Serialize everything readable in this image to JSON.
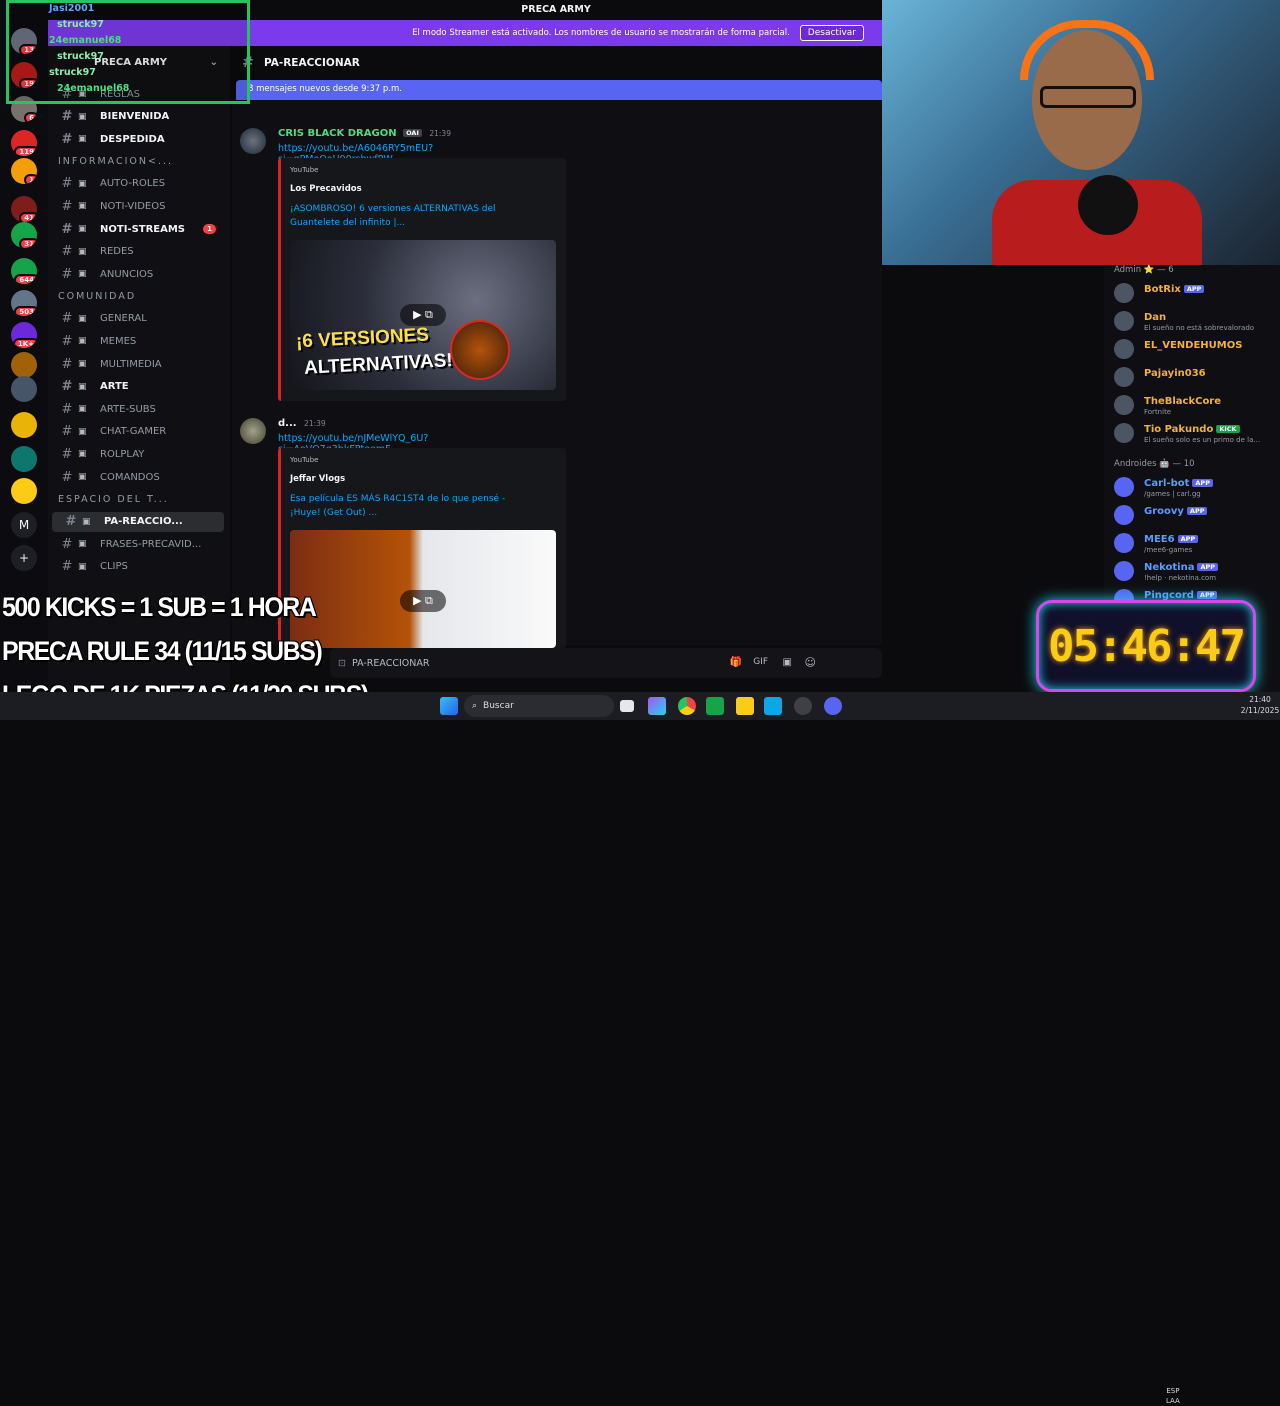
{
  "window": {
    "server_title": "PRECA ARMY"
  },
  "streamer_banner": {
    "text": "El modo Streamer está activado. Los nombres de usuario se mostrarán de forma parcial.",
    "button": "Desactivar"
  },
  "sidebar": {
    "server_name": "PRECA ARMY",
    "items": [
      {
        "type": "channel",
        "name": "REGLAS",
        "bold": false
      },
      {
        "type": "channel",
        "name": "BIENVENIDA",
        "bold": true
      },
      {
        "type": "channel",
        "name": "DESPEDIDA",
        "bold": true
      },
      {
        "type": "category",
        "name": "INFORMACION<..."
      },
      {
        "type": "channel",
        "name": "AUTO-ROLES",
        "bold": false
      },
      {
        "type": "channel",
        "name": "NOTI-VIDEOS",
        "bold": false
      },
      {
        "type": "channel",
        "name": "NOTI-STREAMS",
        "bold": true,
        "badge": "1"
      },
      {
        "type": "channel",
        "name": "REDES",
        "bold": false
      },
      {
        "type": "channel",
        "name": "ANUNCIOS",
        "bold": false
      },
      {
        "type": "category",
        "name": "COMUNIDAD"
      },
      {
        "type": "channel",
        "name": "GENERAL",
        "bold": false
      },
      {
        "type": "channel",
        "name": "MEMES",
        "bold": false
      },
      {
        "type": "channel",
        "name": "MULTIMEDIA",
        "bold": false
      },
      {
        "type": "channel",
        "name": "ARTE",
        "bold": true
      },
      {
        "type": "channel",
        "name": "ARTE-SUBS",
        "bold": false
      },
      {
        "type": "channel",
        "name": "CHAT-GAMER",
        "bold": false
      },
      {
        "type": "channel",
        "name": "ROLPLAY",
        "bold": false
      },
      {
        "type": "channel",
        "name": "COMANDOS",
        "bold": false
      },
      {
        "type": "category",
        "name": "ESPACIO DEL T..."
      },
      {
        "type": "channel",
        "name": "PA-REACCIO...",
        "bold": true,
        "selected": true
      },
      {
        "type": "channel",
        "name": "FRASES-PRECAVID...",
        "bold": false
      },
      {
        "type": "channel",
        "name": "CLIPS",
        "bold": false
      }
    ]
  },
  "rail_badges": [
    "13",
    "19",
    "6",
    "119",
    "1",
    "41",
    "31",
    "644",
    "503",
    "1K+"
  ],
  "channel_header": {
    "name": "PA-REACCIONAR"
  },
  "new_messages_bar": "8 mensajes nuevos desde 9:37 p.m.",
  "messages": [
    {
      "author": "CRIS BLACK DRAGON",
      "author_tag": "OAI",
      "time": "21:39",
      "link": "https://youtu.be/A6046RY5mEU?si=qPMoQoU00rsbwfPW",
      "embed": {
        "provider": "YouTube",
        "channel": "Los Precavidos",
        "title": "¡ASOMBROSO! 6 versiones ALTERNATIVAS del Guantelete del infinito |...",
        "thumb_text": [
          "¡6 VERSIONES",
          "ALTERNATIVAS!"
        ]
      }
    },
    {
      "author": "d...",
      "time": "21:39",
      "link": "https://youtu.be/nJMeWlYQ_6U?si=AoVQ7q3bkFPtoemF",
      "embed": {
        "provider": "YouTube",
        "channel": "Jeffar Vlogs",
        "title": "Esa película ES MÁS R4C1ST4 de lo que pensé - ¡Huye! (Get Out) ..."
      }
    }
  ],
  "input_placeholder": "PA-REACCIONAR",
  "members": {
    "groups": [
      {
        "header": "Admin ⭐ — 6",
        "items": [
          {
            "name": "BotRix",
            "tag": "APP",
            "sub": "",
            "color": "#f0b232"
          },
          {
            "name": "Dan",
            "tag": "",
            "sub": "El sueño no está sobrevalorado",
            "color": "#f0b232"
          },
          {
            "name": "EL_VENDEHUMOS",
            "tag": "",
            "sub": "",
            "color": "#f0b232"
          },
          {
            "name": "Pajayin036",
            "tag": "",
            "sub": "",
            "color": "#f0b232"
          },
          {
            "name": "TheBlackCore",
            "tag": "",
            "sub": "Fortnite",
            "color": "#f0b232"
          },
          {
            "name": "Tio Pakundo",
            "tag": "KICK",
            "sub": "El sueño solo es un primo de la...",
            "color": "#f0b232"
          }
        ]
      },
      {
        "header": "Androides 🤖 — 10",
        "items": [
          {
            "name": "Carl-bot",
            "tag": "APP",
            "sub": "/games | carl.gg",
            "color": "#5b9bff"
          },
          {
            "name": "Groovy",
            "tag": "APP",
            "sub": "",
            "color": "#5b9bff"
          },
          {
            "name": "MEE6",
            "tag": "APP",
            "sub": "/mee6-games",
            "color": "#5b9bff"
          },
          {
            "name": "Nekotina",
            "tag": "APP",
            "sub": "!help · nekotina.com",
            "color": "#5b9bff"
          },
          {
            "name": "Pingcord",
            "tag": "APP",
            "sub": "pingcord.xyz | pingcord | v2",
            "color": "#5b9bff"
          }
        ]
      }
    ]
  },
  "timer": "05:46:47",
  "stream_goals": [
    "500 KICKS = 1 SUB = 1 HORA",
    "PRECA RULE 34 (11/15 SUBS)",
    "LEGO DE 1K PIEZAS (11/20 SUBS)"
  ],
  "stream_chat": [
    {
      "user": "Jasi2001",
      "color": "#60a5fa"
    },
    {
      "user": "struck97",
      "color": "#86efac"
    },
    {
      "user": "24emanuel68",
      "color": "#4ade80"
    },
    {
      "user": "struck97",
      "color": "#86efac"
    },
    {
      "user": "struck97",
      "color": "#86efac"
    },
    {
      "user": "24emanuel68",
      "color": "#4ade80"
    }
  ],
  "taskbar": {
    "search": "Buscar",
    "lang1": "ESP",
    "lang2": "LAA",
    "time": "21:40",
    "date": "2/11/2025"
  }
}
